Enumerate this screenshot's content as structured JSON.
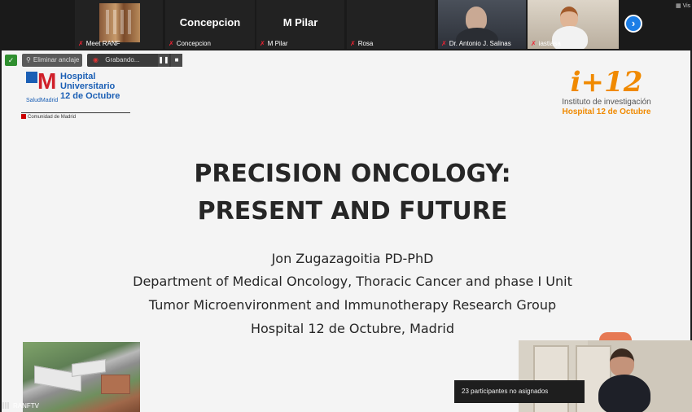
{
  "participants": [
    {
      "id": "meet-ranf",
      "name": "Meet RANF",
      "kind": "thumbnail"
    },
    {
      "id": "concepcion",
      "name": "Concepcion",
      "display": "Concepcion",
      "kind": "text"
    },
    {
      "id": "m-pilar",
      "name": "M Pilar",
      "display": "M Pilar",
      "kind": "text"
    },
    {
      "id": "rosa",
      "name": "Rosa",
      "display": "",
      "kind": "blank"
    },
    {
      "id": "antonio",
      "name": "Dr. Antonio J. Salinas",
      "kind": "video"
    },
    {
      "id": "iastiasa",
      "name": "iastiasa",
      "kind": "video"
    }
  ],
  "toolbar": {
    "unpin_label": "Eliminar anclaje",
    "recording_label": "Grabando...",
    "pause_icon": "pause-icon",
    "stop_icon": "stop-icon",
    "view_label": "Vis"
  },
  "slide": {
    "logo_left": {
      "line1": "Hospital Universitario",
      "line2": "12 de Octubre",
      "line3": "SaludMadrid",
      "line4": "Comunidad de Madrid"
    },
    "logo_right": {
      "mark": "i+12",
      "line1": "Instituto de investigación",
      "line2": "Hospital 12 de Octubre"
    },
    "title_line1": "PRECISION ONCOLOGY:",
    "title_line2": "PRESENT AND FUTURE",
    "author": "Jon Zugazagoitia PD-PhD",
    "affiliation1": "Department of Medical Oncology, Thoracic Cancer and phase I Unit",
    "affiliation2": "Tumor Microenvironment and Immunotherapy Research Group",
    "affiliation3": "Hospital 12 de Octubre, Madrid"
  },
  "toast": "23 participantes no asignados",
  "self_view_label": "RANFTV",
  "colors": {
    "accent": "#1c7ee6",
    "recording": "#e23333",
    "logo_orange": "#f08a00",
    "logo_blue": "#1b5fb5"
  }
}
